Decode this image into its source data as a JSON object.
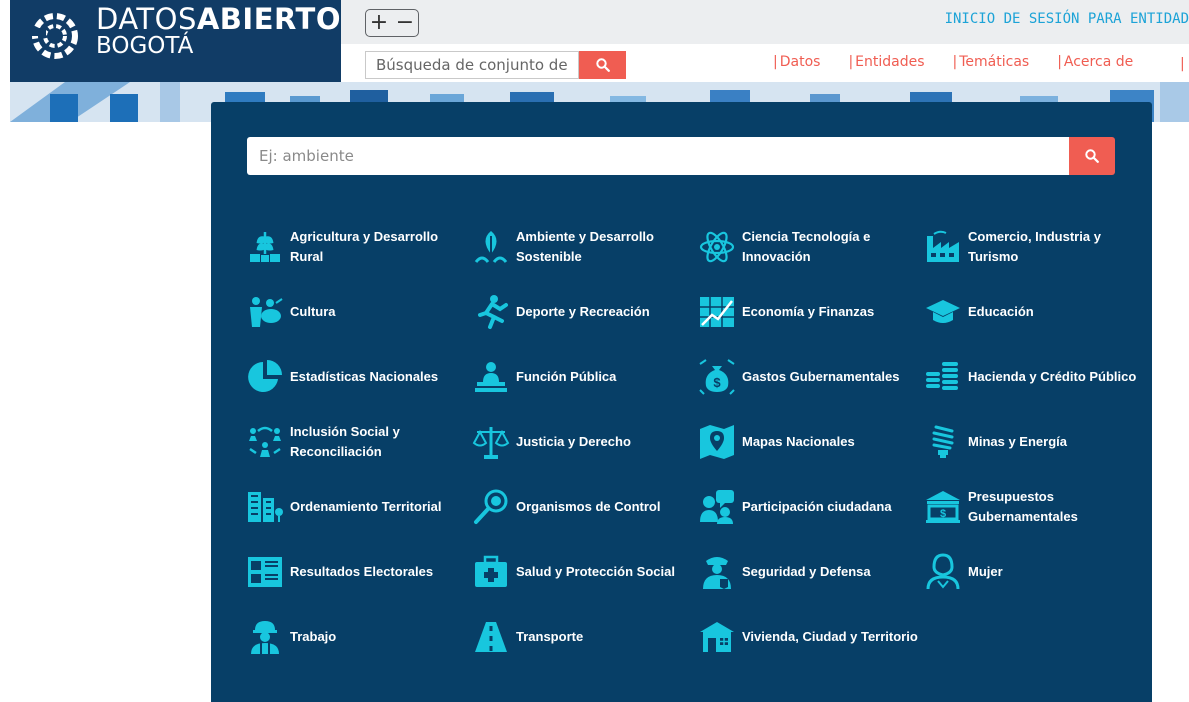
{
  "logo": {
    "line1_thin": "DATOS",
    "line1_bold": "ABIERTOS",
    "line2": "BOGOTÁ"
  },
  "zoom": {
    "plus": "+",
    "minus": "−"
  },
  "login_link": "INICIO DE SESIÓN PARA ENTIDAD",
  "top_search": {
    "placeholder": "Búsqueda de conjunto de"
  },
  "nav": {
    "items": [
      "Datos",
      "Entidades",
      "Temáticas",
      "Acerca de"
    ],
    "trailing_separator": "|"
  },
  "panel_search": {
    "placeholder": "Ej: ambiente"
  },
  "categories": [
    {
      "label": "Agricultura y Desarrollo Rural",
      "icon": "agriculture-icon"
    },
    {
      "label": "Ambiente y Desarrollo Sostenible",
      "icon": "environment-icon"
    },
    {
      "label": "Ciencia Tecnología e Innovación",
      "icon": "science-icon"
    },
    {
      "label": "Comercio, Industria y Turismo",
      "icon": "factory-icon"
    },
    {
      "label": "Cultura",
      "icon": "culture-icon"
    },
    {
      "label": "Deporte y Recreación",
      "icon": "sport-icon"
    },
    {
      "label": "Economía y Finanzas",
      "icon": "economy-icon"
    },
    {
      "label": "Educación",
      "icon": "graduation-cap-icon"
    },
    {
      "label": "Estadísticas Nacionales",
      "icon": "pie-chart-icon"
    },
    {
      "label": "Función Pública",
      "icon": "public-function-icon"
    },
    {
      "label": "Gastos Gubernamentales",
      "icon": "money-bag-icon"
    },
    {
      "label": "Hacienda y Crédito Público",
      "icon": "coins-icon"
    },
    {
      "label": "Inclusión Social y Reconciliación",
      "icon": "inclusion-icon"
    },
    {
      "label": "Justicia y Derecho",
      "icon": "scales-icon"
    },
    {
      "label": "Mapas Nacionales",
      "icon": "map-icon"
    },
    {
      "label": "Minas y Energía",
      "icon": "energy-bulb-icon"
    },
    {
      "label": "Ordenamiento Territorial",
      "icon": "buildings-icon"
    },
    {
      "label": "Organismos de Control",
      "icon": "magnifier-icon"
    },
    {
      "label": "Participación ciudadana",
      "icon": "participation-icon"
    },
    {
      "label": "Presupuestos Gubernamentales",
      "icon": "budget-icon"
    },
    {
      "label": "Resultados Electorales",
      "icon": "election-icon"
    },
    {
      "label": "Salud y Protección Social",
      "icon": "health-icon"
    },
    {
      "label": "Seguridad y Defensa",
      "icon": "police-icon"
    },
    {
      "label": "Mujer",
      "icon": "woman-icon"
    },
    {
      "label": "Trabajo",
      "icon": "worker-icon"
    },
    {
      "label": "Transporte",
      "icon": "road-icon"
    },
    {
      "label": "Vivienda, Ciudad y Territorio",
      "icon": "house-icon"
    }
  ],
  "colors": {
    "brand_blue": "#113c66",
    "panel_blue": "#073f67",
    "accent_red": "#f05d52",
    "icon_cyan": "#18c6de",
    "link_blue": "#1ca3d7"
  }
}
